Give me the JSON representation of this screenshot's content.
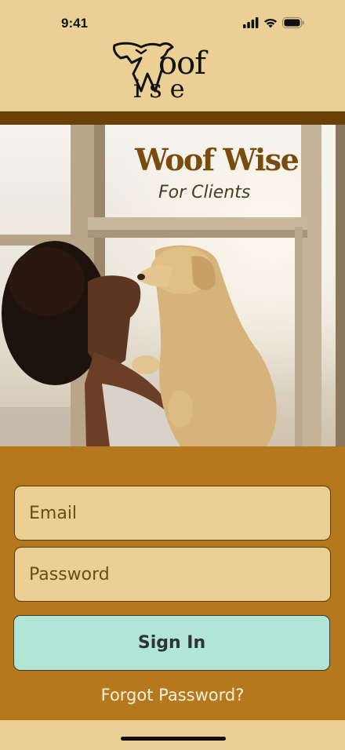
{
  "status_bar": {
    "time": "9:41",
    "icons": [
      "signal-icon",
      "wifi-icon",
      "battery-icon"
    ]
  },
  "logo": {
    "line1": "oof",
    "line2": "ise",
    "mark_letters": "WW"
  },
  "hero": {
    "title": "Woof Wise",
    "subtitle": "For Clients"
  },
  "form": {
    "email_placeholder": "Email",
    "password_placeholder": "Password",
    "sign_in_label": "Sign In",
    "forgot_password_label": "Forgot Password?"
  },
  "colors": {
    "cream": "#ead094",
    "dark_brown": "#6b4006",
    "amber": "#b5781c",
    "mint": "#b1e5d5"
  }
}
